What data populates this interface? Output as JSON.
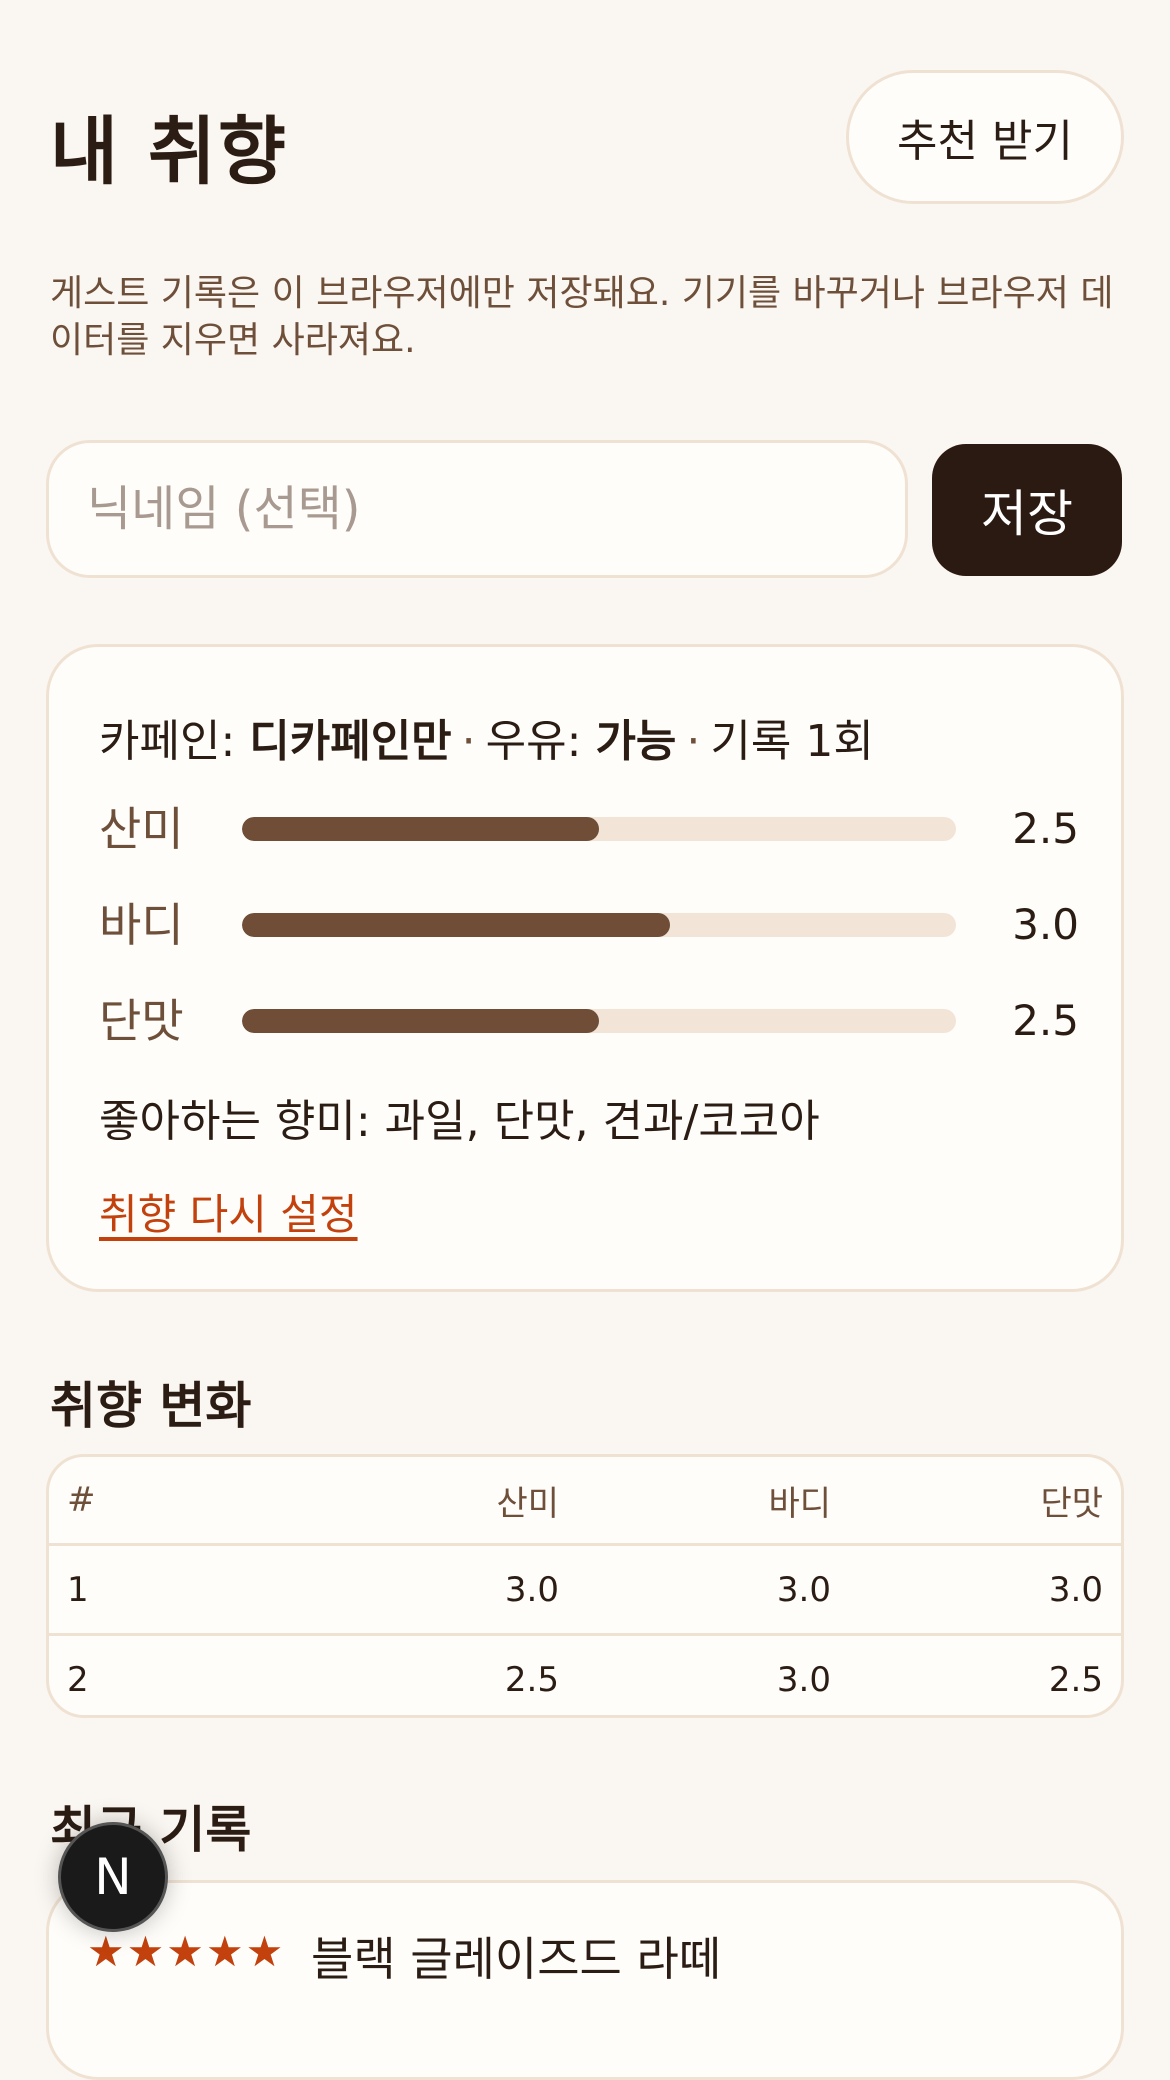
{
  "header": {
    "title": "내 취향",
    "recommend_button": "추천 받기"
  },
  "notice": "게스트 기록은 이 브라우저에만 저장돼요. 기기를 바꾸거나 브라우저 데이터를 지우면 사라져요.",
  "nickname": {
    "placeholder": "닉네임 (선택)",
    "value": "",
    "save_button": "저장"
  },
  "profile": {
    "caffeine_label": "카페인: ",
    "caffeine_value": "디카페인만",
    "sep": "·",
    "milk_label": "우유: ",
    "milk_value": "가능",
    "records": "기록 1회",
    "bars": [
      {
        "label": "산미",
        "value": "2.5",
        "fraction": 0.5
      },
      {
        "label": "바디",
        "value": "3.0",
        "fraction": 0.6
      },
      {
        "label": "단맛",
        "value": "2.5",
        "fraction": 0.5
      }
    ],
    "liked_flavors": "좋아하는 향미: 과일, 단맛, 견과/코코아",
    "reset_link": "취향 다시 설정"
  },
  "history": {
    "heading": "취향 변화",
    "columns": [
      "#",
      "산미",
      "바디",
      "단맛"
    ],
    "rows": [
      [
        "1",
        "3.0",
        "3.0",
        "3.0"
      ],
      [
        "2",
        "2.5",
        "3.0",
        "2.5"
      ]
    ]
  },
  "recent": {
    "heading": "최근 기록",
    "items": [
      {
        "stars": "★★★★★",
        "rating": 5,
        "name": "블랙 글레이즈드 라떼"
      }
    ]
  },
  "fab_label": "N",
  "colors": {
    "background": "#faf6f1",
    "primary_dark": "#2b1a12",
    "bar_fill": "#6f4d36",
    "bar_track": "#f2e5d7",
    "accent": "#c2410c"
  }
}
